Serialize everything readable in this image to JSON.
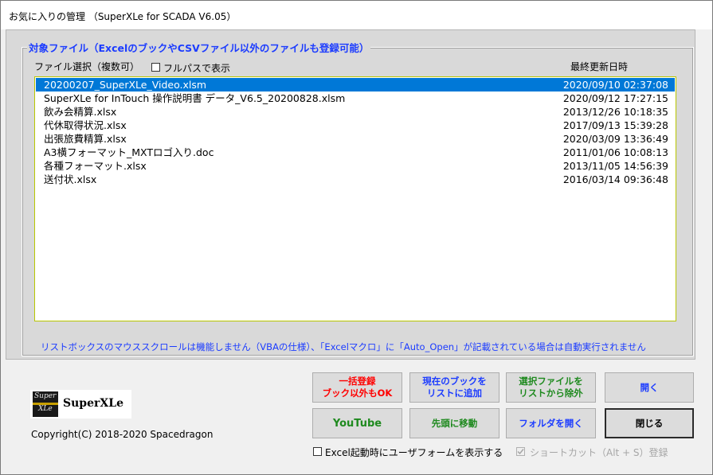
{
  "window": {
    "title": "お気に入りの管理 （SuperXLe for SCADA V6.05）"
  },
  "frame": {
    "title": "対象ファイル（ExcelのブックやCSVファイル以外のファイルも登録可能）"
  },
  "list": {
    "select_label": "ファイル選択（複数可）",
    "fullpath_label": "フルパスで表示",
    "fullpath_checked": false,
    "date_header": "最終更新日時",
    "items": [
      {
        "name": "20200207_SuperXLe_Video.xlsm",
        "date": "2020/09/10 02:37:08",
        "selected": true
      },
      {
        "name": "SuperXLe for InTouch 操作説明書 データ_V6.5_20200828.xlsm",
        "date": "2020/09/12 17:27:15",
        "selected": false
      },
      {
        "name": "飲み会精算.xlsx",
        "date": "2013/12/26 10:18:35",
        "selected": false
      },
      {
        "name": "代休取得状況.xlsx",
        "date": "2017/09/13 15:39:28",
        "selected": false
      },
      {
        "name": "出張旅費精算.xlsx",
        "date": "2020/03/09 13:36:49",
        "selected": false
      },
      {
        "name": "A3横フォーマット_MXTロゴ入り.doc",
        "date": "2011/01/06 10:08:13",
        "selected": false
      },
      {
        "name": "各種フォーマット.xlsx",
        "date": "2013/11/05 14:56:39",
        "selected": false
      },
      {
        "name": "送付状.xlsx",
        "date": "2016/03/14 09:36:48",
        "selected": false
      }
    ]
  },
  "notice": "リストボックスのマウススクロールは機能しません（VBAの仕様）、「Excelマクロ」に「Auto_Open」が記載されている場合は自動実行されません",
  "logo": {
    "mark_top": "Super",
    "mark_bottom": "XLe",
    "text": "SuperXLe"
  },
  "copyright": "Copyright(C) 2018-2020 Spacedragon",
  "buttons": {
    "bulk_register": "一括登録\nブック以外もOK",
    "add_current": "現在のブックを\nリストに追加",
    "remove_selected": "選択ファイルを\nリストから除外",
    "open": "開く",
    "youtube": "YouTube",
    "move_top": "先頭に移動",
    "open_folder": "フォルダを開く",
    "close": "閉じる"
  },
  "options": {
    "show_form_on_start": "Excel起動時にユーザフォームを表示する",
    "show_form_checked": false,
    "shortcut": "ショートカット（Alt + S）登録",
    "shortcut_checked": true
  },
  "colors": {
    "selection": "#0078d7",
    "accent_blue": "#1c3cff",
    "alert_red": "#ff0000",
    "green": "#1f8a1f",
    "list_border": "#b8c600"
  }
}
